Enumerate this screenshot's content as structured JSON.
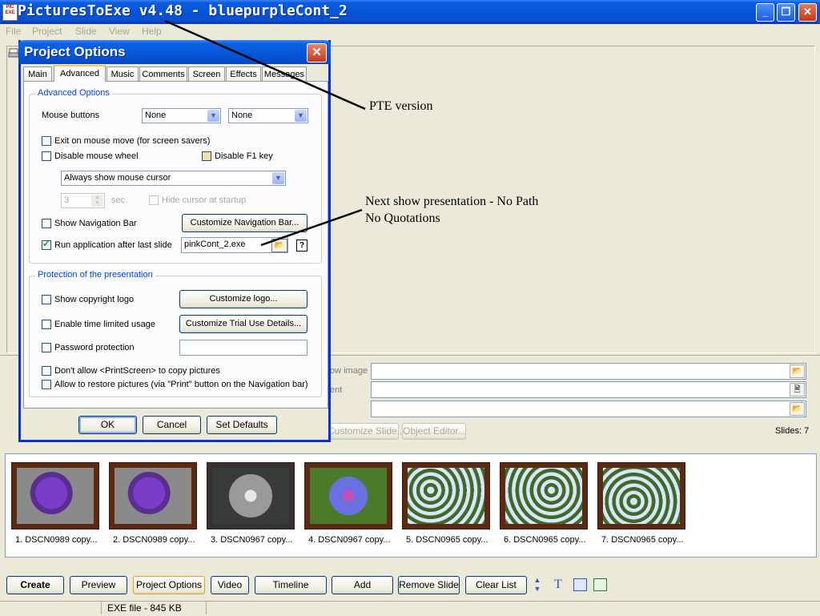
{
  "window": {
    "title": "PicturesToExe v4.48 - bluepurpleCont_2",
    "icon_text": "PIC EXE",
    "controls": {
      "minimize": "_",
      "maximize": "❐",
      "close": "✕"
    }
  },
  "menu": [
    "File",
    "Project",
    "Slide",
    "View",
    "Help"
  ],
  "dialog": {
    "title": "Project Options",
    "close_glyph": "✕",
    "tabs": [
      "Main",
      "Advanced",
      "Music",
      "Comments",
      "Screen",
      "Effects",
      "Messages"
    ],
    "active_tab": "Advanced",
    "advanced_group": {
      "label": "Advanced Options",
      "mouse_buttons_label": "Mouse buttons",
      "mouse_button_1": "None",
      "mouse_button_2": "None",
      "exit_on_mouse_move": "Exit on mouse move (for screen savers)",
      "disable_mouse_wheel": "Disable mouse wheel",
      "disable_f1": "Disable F1 key",
      "cursor_mode": "Always show mouse cursor",
      "cursor_seconds": "3",
      "sec_label": "sec.",
      "hide_cursor": "Hide cursor at startup",
      "show_nav_bar": "Show Navigation Bar",
      "customize_nav_bar": "Customize Navigation Bar...",
      "run_app": "Run application after last slide",
      "run_app_file": "pinkCont_2.exe",
      "help_glyph": "?"
    },
    "protection_group": {
      "label": "Protection of the presentation",
      "show_logo": "Show copyright logo",
      "customize_logo": "Customize logo...",
      "time_limited": "Enable time limited usage",
      "customize_trial": "Customize Trial Use Details...",
      "password": "Password protection",
      "no_printscreen": "Don't allow <PrintScreen> to copy pictures",
      "allow_restore": "Allow to restore pictures (via \"Print\" button on the Navigation bar)"
    },
    "buttons": {
      "ok": "OK",
      "cancel": "Cancel",
      "defaults": "Set Defaults"
    }
  },
  "slide_props": {
    "image_label_tail": "ow image",
    "comment_label_tail": "ent",
    "customize_slide": "Customize Slide...",
    "object_editor": "Object Editor...",
    "slides_count": "Slides: 7"
  },
  "thumbnails": [
    {
      "caption": "1. DSCN0989 copy..."
    },
    {
      "caption": "2. DSCN0989 copy..."
    },
    {
      "caption": "3. DSCN0967 copy..."
    },
    {
      "caption": "4. DSCN0967 copy..."
    },
    {
      "caption": "5. DSCN0965 copy..."
    },
    {
      "caption": "6. DSCN0965 copy..."
    },
    {
      "caption": "7. DSCN0965 copy..."
    }
  ],
  "toolbar": {
    "create": "Create",
    "preview": "Preview",
    "project_options": "Project Options",
    "video": "Video",
    "timeline": "Timeline",
    "add": "Add",
    "remove_slide": "Remove Slide",
    "clear_list": "Clear List"
  },
  "status": {
    "exe_file": "EXE file - 845 KB"
  },
  "annotations": {
    "pte_version": "PTE version",
    "next_show_line1": "Next show presentation - No Path",
    "next_show_line2": "No Quotations"
  }
}
